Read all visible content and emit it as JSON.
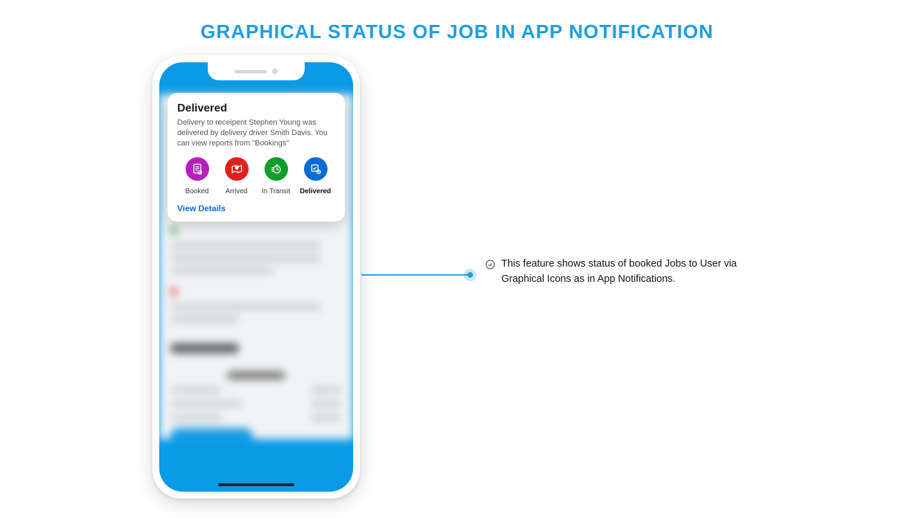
{
  "page": {
    "title": "GRAPHICAL STATUS OF JOB IN APP NOTIFICATION"
  },
  "notification": {
    "title": "Delivered",
    "description": "Delivery to receipent Stephen Young was delivered by delivery driver Smith Davis. You can view reports from \"Bookings\"",
    "statuses": [
      {
        "label": "Booked",
        "icon": "receipt-icon",
        "color": "purple",
        "active": false
      },
      {
        "label": "Arrived",
        "icon": "map-pin-icon",
        "color": "red",
        "active": false
      },
      {
        "label": "In Transit",
        "icon": "stopwatch-icon",
        "color": "green",
        "active": false
      },
      {
        "label": "Delivered",
        "icon": "package-ok-icon",
        "color": "blue",
        "active": true
      }
    ],
    "view_details": "View Details"
  },
  "callout": {
    "text": "This feature shows status of booked Jobs to User via Graphical Icons as in App Notifications."
  }
}
